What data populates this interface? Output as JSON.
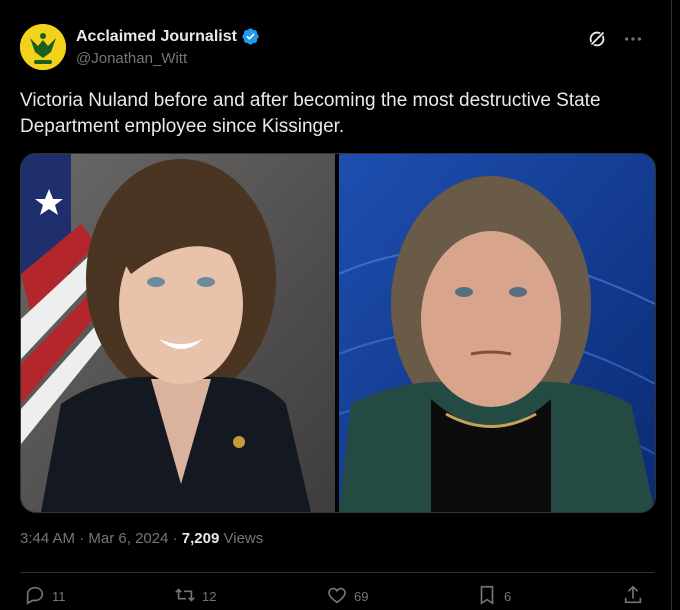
{
  "author": {
    "display_name": "Acclaimed Journalist",
    "handle": "@Jonathan_Witt",
    "verified": true
  },
  "post": {
    "text": "Victoria Nuland before and after becoming the most destructive State Department employee since Kissinger.",
    "time": "3:44 AM",
    "separator1": "·",
    "date": "Mar 6, 2024",
    "separator2": "·",
    "views_count": "7,209",
    "views_label": "Views"
  },
  "actions": {
    "replies": "11",
    "reposts": "12",
    "likes": "69",
    "bookmarks": "6"
  },
  "icons": [
    "verified-badge-icon",
    "grok-icon",
    "more-icon",
    "reply-icon",
    "repost-icon",
    "like-icon",
    "bookmark-icon",
    "share-icon"
  ],
  "colors": {
    "background": "#000000",
    "text": "#e7e9ea",
    "secondary": "#71767b",
    "verified": "#1d9bf0",
    "avatar_bg": "#f3d21a"
  }
}
